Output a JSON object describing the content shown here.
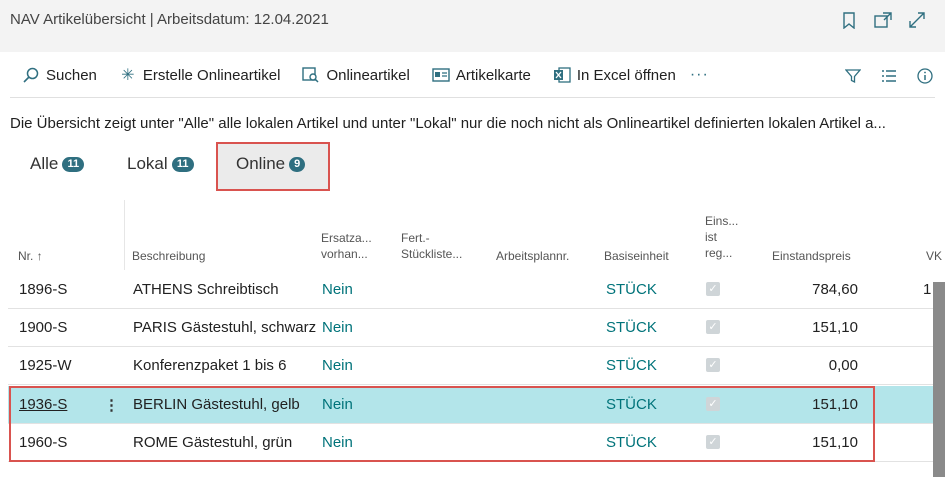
{
  "header": {
    "title": "NAV Artikelübersicht | Arbeitsdatum: 12.04.2021",
    "icons": [
      "bookmark-icon",
      "open-new-window-icon",
      "expand-icon"
    ]
  },
  "actions": [
    {
      "label": "Suchen",
      "icon": "search-icon"
    },
    {
      "label": "Erstelle Onlineartikel",
      "icon": "spark-icon"
    },
    {
      "label": "Onlineartikel",
      "icon": "list-search-icon"
    },
    {
      "label": "Artikelkarte",
      "icon": "card-icon"
    },
    {
      "label": "In Excel öffnen",
      "icon": "excel-icon"
    }
  ],
  "more_label": "···",
  "info_text": "Die Übersicht zeigt unter \"Alle\" alle lokalen Artikel und unter \"Lokal\" nur die noch nicht als Onlineartikel definierten lokalen Artikel a...",
  "tabs": [
    {
      "label": "Alle",
      "count": "11"
    },
    {
      "label": "Lokal",
      "count": "11"
    },
    {
      "label": "Online",
      "count": "9"
    }
  ],
  "columns": {
    "nr": "Nr. ↑",
    "desc": "Beschreibung",
    "ersatz": "Ersatza...\nvorhan...",
    "fert": "Fert.-\nStückliste...",
    "arbeitsplan": "Arbeitsplannr.",
    "basis": "Basiseinheit",
    "einst": "Eins...\nist\nreg...",
    "preis": "Einstandspreis",
    "vk": "VK"
  },
  "rows": [
    {
      "nr": "1896-S",
      "desc": "ATHENS Schreibtisch",
      "ersatz": "Nein",
      "unit": "STÜCK",
      "price": "784,60",
      "vk": "1"
    },
    {
      "nr": "1900-S",
      "desc": "PARIS Gästestuhl, schwarz",
      "ersatz": "Nein",
      "unit": "STÜCK",
      "price": "151,10",
      "vk": ""
    },
    {
      "nr": "1925-W",
      "desc": "Konferenzpaket 1 bis 6",
      "ersatz": "Nein",
      "unit": "STÜCK",
      "price": "0,00",
      "vk": ""
    },
    {
      "nr": "1936-S",
      "desc": "BERLIN Gästestuhl, gelb",
      "ersatz": "Nein",
      "unit": "STÜCK",
      "price": "151,10",
      "vk": ""
    },
    {
      "nr": "1960-S",
      "desc": "ROME Gästestuhl, grün",
      "ersatz": "Nein",
      "unit": "STÜCK",
      "price": "151,10",
      "vk": ""
    }
  ]
}
